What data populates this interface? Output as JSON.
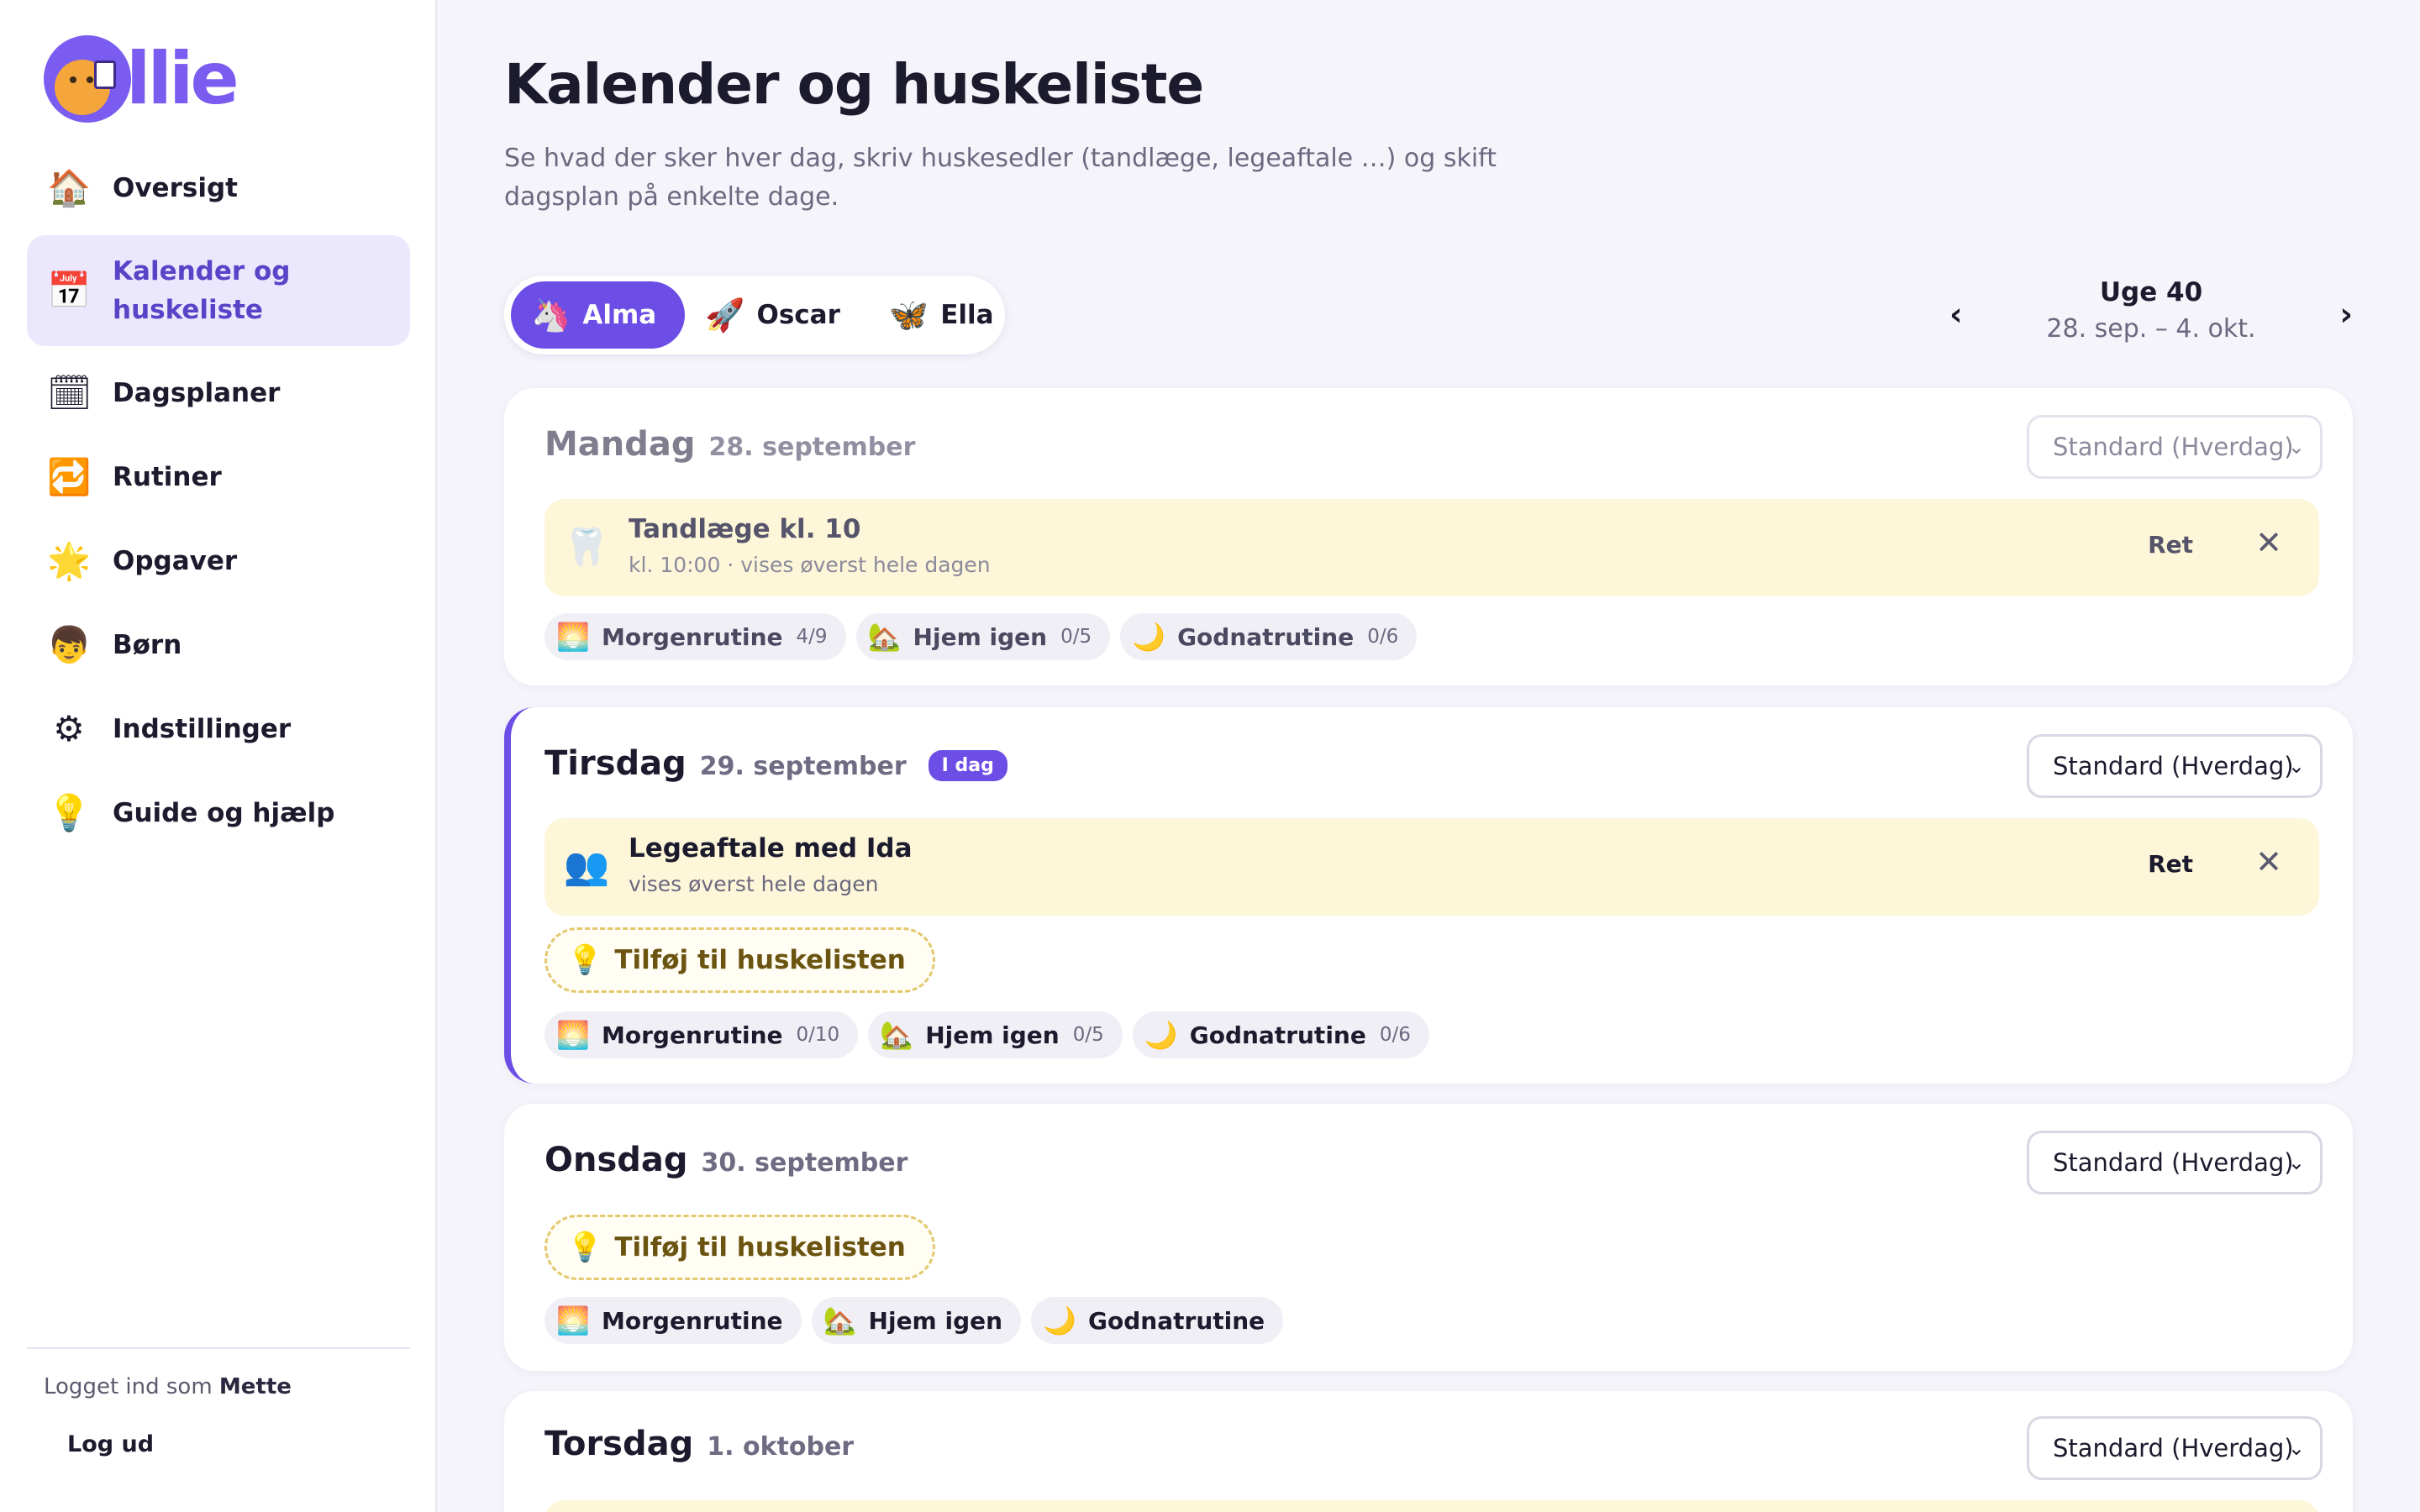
{
  "app": {
    "logo_text": "llie",
    "colors": {
      "accent": "#6c4ee6",
      "note_bg": "#fdf6d8",
      "bg": "#f5f4fa"
    }
  },
  "sidebar": {
    "items": [
      {
        "label": "Oversigt",
        "icon": "house-icon",
        "glyph": "🏠",
        "active": false
      },
      {
        "label": "Kalender og huskeliste",
        "icon": "calendar-icon",
        "glyph": "📅",
        "active": true
      },
      {
        "label": "Dagsplaner",
        "icon": "calendar-icon",
        "glyph": "🗓",
        "active": false
      },
      {
        "label": "Rutiner",
        "icon": "repeat-icon",
        "glyph": "🔁",
        "active": false
      },
      {
        "label": "Opgaver",
        "icon": "star-icon",
        "glyph": "🌟",
        "active": false
      },
      {
        "label": "Børn",
        "icon": "child-icon",
        "glyph": "👦",
        "active": false
      },
      {
        "label": "Indstillinger",
        "icon": "gear-icon",
        "glyph": "⚙",
        "active": false
      },
      {
        "label": "Guide og hjælp",
        "icon": "lightbulb-icon",
        "glyph": "💡",
        "active": false
      }
    ],
    "footer": {
      "logged_in_prefix": "Logget ind som",
      "user": "Mette",
      "logout": "Log ud"
    }
  },
  "main": {
    "title": "Kalender og huskeliste",
    "subtitle": "Se hvad der sker hver dag, skriv huskesedler (tandlæge, legeaftale …) og skift dagsplan på enkelte dage.",
    "kids": [
      {
        "name": "Alma",
        "glyph": "🦄",
        "icon": "unicorn-icon",
        "active": true
      },
      {
        "name": "Oscar",
        "glyph": "🚀",
        "icon": "rocket-icon",
        "active": false
      },
      {
        "name": "Ella",
        "glyph": "🦋",
        "icon": "butterfly-icon",
        "active": false
      }
    ],
    "week": {
      "label": "Uge 40",
      "range": "28. sep. – 4. okt.",
      "prev": "‹",
      "next": "›"
    },
    "days": [
      {
        "name": "Mandag",
        "date": "28. september",
        "plan": "Standard (Hverdag)",
        "note": {
          "title": "Tandlæge kl. 10",
          "sub": "kl. 10:00 · vises øverst hele dagen",
          "icon": "tooth-icon",
          "glyph": "🦷",
          "edit": "Ret",
          "close": "✕"
        },
        "routines": [
          {
            "name": "Morgenrutine",
            "count": "4/9",
            "glyph": "🌅",
            "icon": "sunrise-icon"
          },
          {
            "name": "Hjem igen",
            "count": "0/5",
            "glyph": "🏡",
            "icon": "house-icon"
          },
          {
            "name": "Godnatrutine",
            "count": "0/6",
            "glyph": "🌙",
            "icon": "moon-icon"
          }
        ]
      },
      {
        "name": "Tirsdag",
        "date": "29. september",
        "today_badge": "I dag",
        "plan": "Standard (Hverdag)",
        "note": {
          "title": "Legeaftale med Ida",
          "sub": "vises øverst hele dagen",
          "icon": "people-icon",
          "glyph": "👥",
          "edit": "Ret",
          "close": "✕"
        },
        "add_note": "Tilføj til huskelisten",
        "routines": [
          {
            "name": "Morgenrutine",
            "count": "0/10",
            "glyph": "🌅",
            "icon": "sunrise-icon"
          },
          {
            "name": "Hjem igen",
            "count": "0/5",
            "glyph": "🏡",
            "icon": "house-icon"
          },
          {
            "name": "Godnatrutine",
            "count": "0/6",
            "glyph": "🌙",
            "icon": "moon-icon"
          }
        ]
      },
      {
        "name": "Onsdag",
        "date": "30. september",
        "plan": "Standard (Hverdag)",
        "add_note": "Tilføj til huskelisten",
        "routines": [
          {
            "name": "Morgenrutine",
            "glyph": "🌅",
            "icon": "sunrise-icon"
          },
          {
            "name": "Hjem igen",
            "glyph": "🏡",
            "icon": "house-icon"
          },
          {
            "name": "Godnatrutine",
            "glyph": "🌙",
            "icon": "moon-icon"
          }
        ]
      },
      {
        "name": "Torsdag",
        "date": "1. oktober",
        "plan": "Standard (Hverdag)"
      }
    ],
    "add_note_bulb": "💡",
    "select_chevron": "⌄"
  }
}
